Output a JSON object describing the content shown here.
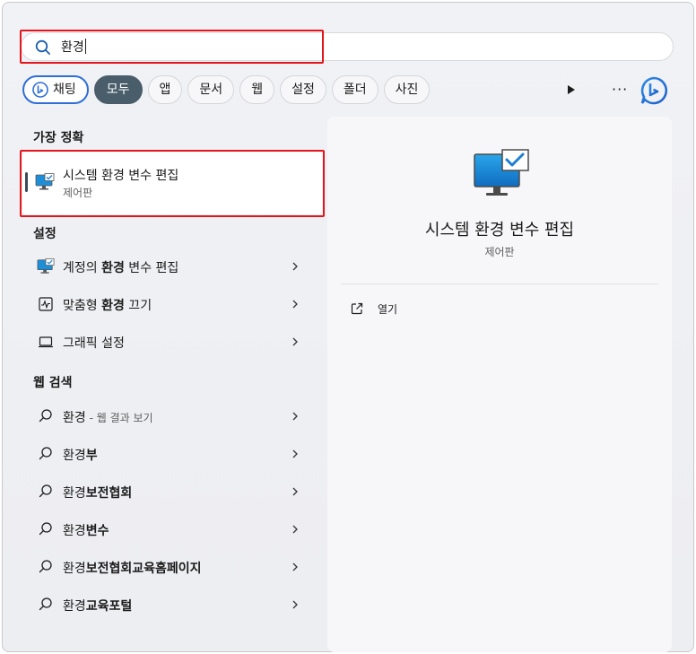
{
  "search": {
    "query": "환경"
  },
  "chips": {
    "chat": "채팅",
    "all": "모두",
    "apps": "앱",
    "documents": "문서",
    "web": "웹",
    "settings": "설정",
    "folders": "폴더",
    "photos": "사진"
  },
  "more": "···",
  "sections": {
    "best_match": "가장 정확",
    "settings": "설정",
    "web_search": "웹 검색"
  },
  "best_match": {
    "name": "시스템 환경 변수 편집",
    "subtitle": "제어판"
  },
  "settings_items": [
    {
      "pre": "계정의 ",
      "bold": "환경",
      "post": " 변수 편집"
    },
    {
      "pre": "맞춤형 ",
      "bold": "환경",
      "post": " 끄기"
    },
    {
      "pre": "그래픽 설정",
      "bold": "",
      "post": ""
    }
  ],
  "web_items": [
    {
      "pre": "환경",
      "bold": "",
      "post": " - 웹 결과 보기"
    },
    {
      "pre": "환경",
      "bold": "부",
      "post": ""
    },
    {
      "pre": "환경",
      "bold": "보전협회",
      "post": ""
    },
    {
      "pre": "환경",
      "bold": "변수",
      "post": ""
    },
    {
      "pre": "환경",
      "bold": "보전협회교육홈페이지",
      "post": ""
    },
    {
      "pre": "환경",
      "bold": "교육포털",
      "post": ""
    }
  ],
  "preview": {
    "title": "시스템 환경 변수 편집",
    "subtitle": "제어판",
    "open_label": "열기"
  },
  "colors": {
    "accent": "#2e6fd6",
    "highlight": "#e3161d",
    "active_chip": "#4a5d6b"
  }
}
